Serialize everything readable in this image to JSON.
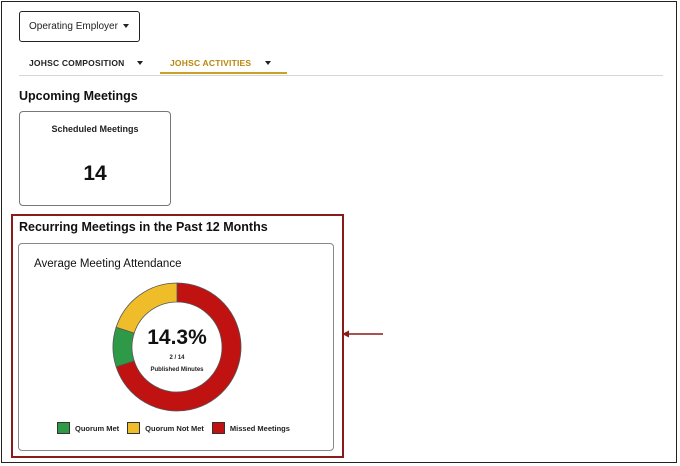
{
  "employer_select": {
    "value": "Operating Employer",
    "icon": "chevron-down-icon"
  },
  "tabs": [
    {
      "label": "JOHSC COMPOSITION",
      "active": false
    },
    {
      "label": "JOHSC ACTIVITIES",
      "active": true
    }
  ],
  "upcoming": {
    "title": "Upcoming Meetings",
    "scheduled_card": {
      "label": "Scheduled Meetings",
      "value": "14"
    }
  },
  "recurring": {
    "title": "Recurring Meetings in the Past 12 Months",
    "attendance_card": {
      "title": "Average Meeting Attendance",
      "center_percent": "14.3%",
      "center_ratio": "2 / 14",
      "center_caption": "Published Minutes"
    }
  },
  "chart_data": {
    "type": "pie",
    "title": "Average Meeting Attendance",
    "categories": [
      "Quorum Met",
      "Quorum Not Met",
      "Missed Meetings"
    ],
    "values": [
      1,
      2,
      7
    ],
    "colors": [
      "#2e9a48",
      "#f0bd2a",
      "#c11212"
    ]
  },
  "colors": {
    "accent": "#c9a227",
    "highlight_border": "#8b1a1a",
    "arrow": "#8b1a1a"
  }
}
